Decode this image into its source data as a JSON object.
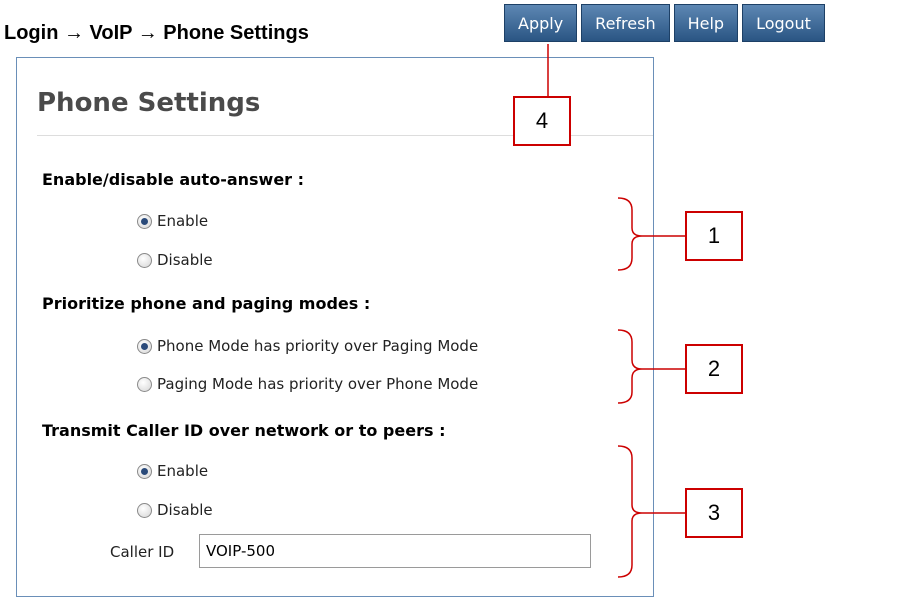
{
  "breadcrumb": "Login → VoIP → Phone Settings",
  "toolbar": {
    "apply": "Apply",
    "refresh": "Refresh",
    "help": "Help",
    "logout": "Logout"
  },
  "page_title": "Phone Settings",
  "auto_answer": {
    "heading": "Enable/disable auto-answer :",
    "options": [
      {
        "label": "Enable",
        "selected": true
      },
      {
        "label": "Disable",
        "selected": false
      }
    ]
  },
  "priority": {
    "heading": "Prioritize phone and paging modes :",
    "options": [
      {
        "label": "Phone Mode has priority over Paging Mode",
        "selected": true
      },
      {
        "label": "Paging Mode has priority over Phone Mode",
        "selected": false
      }
    ]
  },
  "caller_id": {
    "heading": "Transmit Caller ID over network or to peers :",
    "options": [
      {
        "label": "Enable",
        "selected": true
      },
      {
        "label": "Disable",
        "selected": false
      }
    ],
    "field_label": "Caller ID",
    "field_value": "VOIP-500"
  },
  "callouts": [
    "1",
    "2",
    "3",
    "4"
  ],
  "colors": {
    "button": "#2a5583",
    "callout": "#cc0000",
    "panel_border": "#6a8fb8"
  }
}
